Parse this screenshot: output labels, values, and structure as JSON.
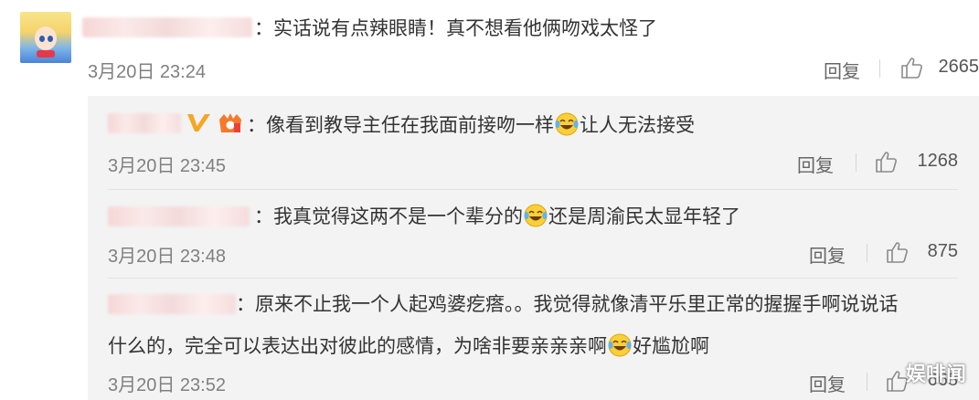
{
  "main_comment": {
    "text": "：实话说有点辣眼睛！真不想看他俩吻戏太怪了",
    "time": "3月20日 23:24",
    "reply_label": "回复",
    "likes": "2665"
  },
  "replies": [
    {
      "text_before": "：像看到教导主任在我面前接吻一样",
      "emoji": "laughing-crying-emoji",
      "text_after": "让人无法接受",
      "time": "3月20日 23:45",
      "reply_label": "回复",
      "likes": "1268",
      "verified": true
    },
    {
      "text_before": "：我真觉得这两不是一个辈分的",
      "emoji": "laughing-crying-emoji",
      "text_after": "还是周渝民太显年轻了",
      "time": "3月20日 23:48",
      "reply_label": "回复",
      "likes": "875"
    },
    {
      "line1": "：原来不止我一个人起鸡婆疙瘩。。我觉得就像清平乐里正常的握握手啊说说话",
      "line2_before": "什么的，完全可以表达出对彼此的感情，为啥非要亲亲亲啊",
      "emoji": "laughing-crying-emoji",
      "line2_after": "好尴尬啊",
      "time": "3月20日 23:52",
      "reply_label": "回复",
      "likes": "668"
    }
  ],
  "watermark": "娱啡闻",
  "colors": {
    "text": "#333333",
    "time": "#808080",
    "reply_bg": "#f3f3f3",
    "verified": "#f5a623"
  }
}
